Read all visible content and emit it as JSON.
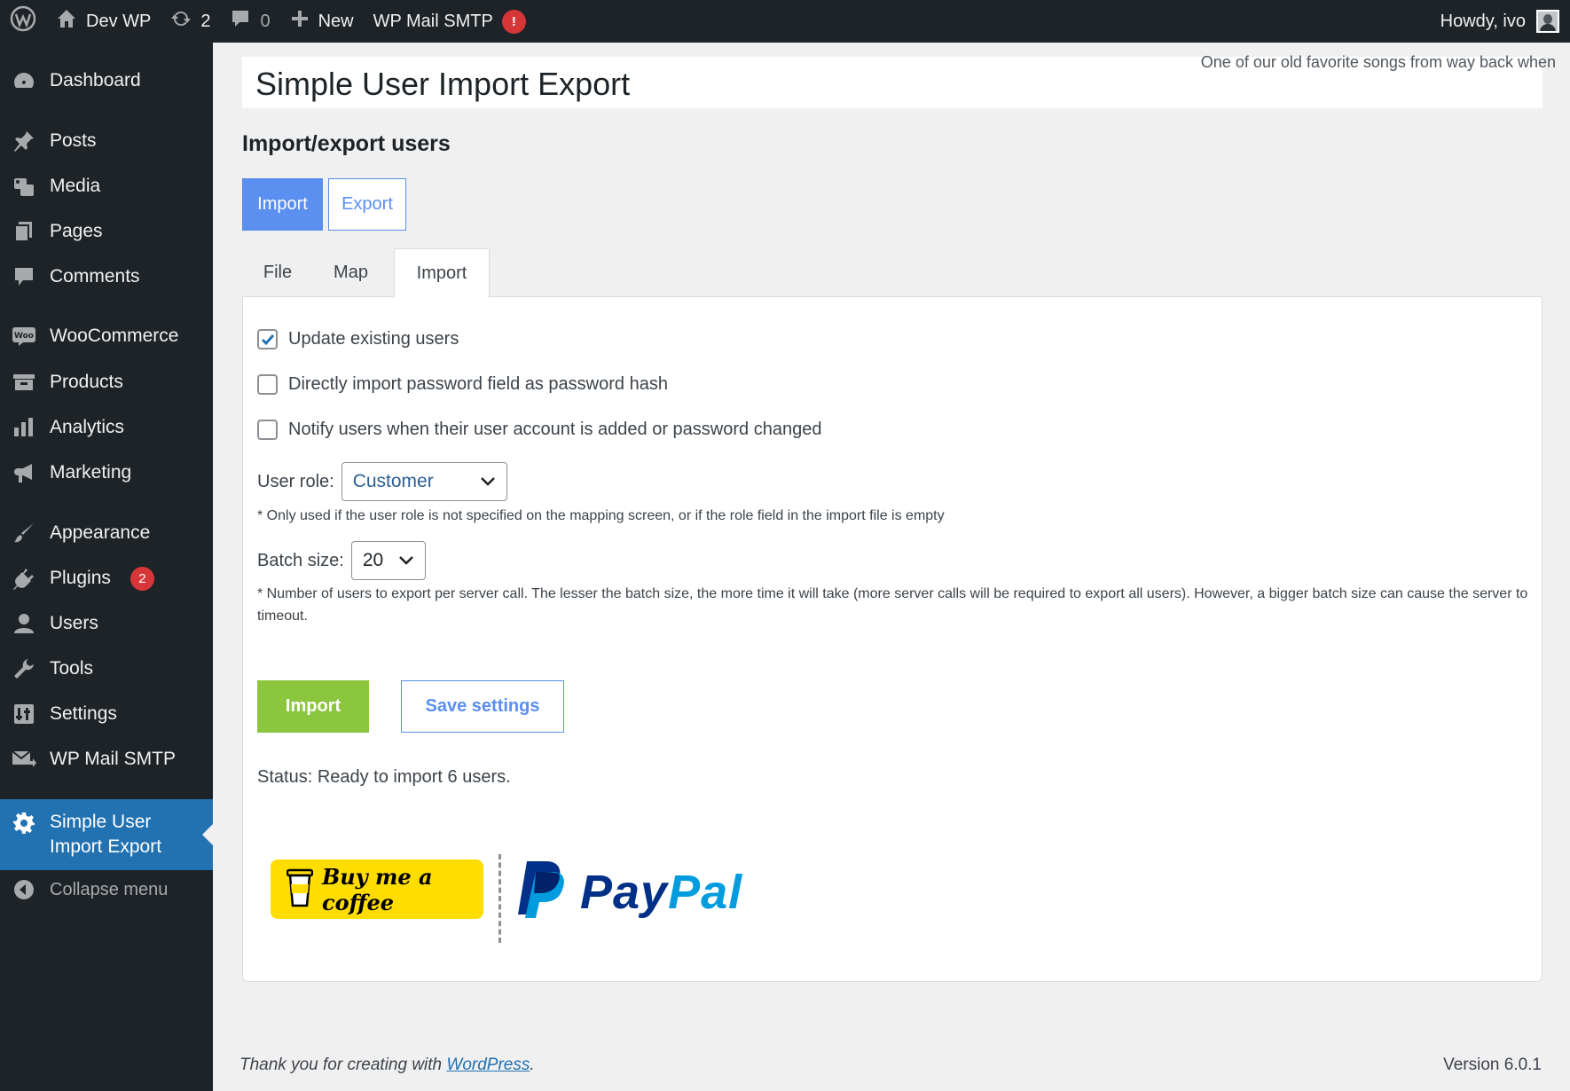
{
  "adminbar": {
    "site_name": "Dev WP",
    "updates_count": "2",
    "comments_count": "0",
    "new_label": "New",
    "smtp_label": "WP Mail SMTP",
    "smtp_alert": "!",
    "howdy": "Howdy, ivo"
  },
  "sidebar": {
    "items": [
      {
        "label": "Dashboard",
        "icon": "dashboard-icon"
      },
      {
        "label": "Posts",
        "icon": "pin-icon"
      },
      {
        "label": "Media",
        "icon": "media-icon"
      },
      {
        "label": "Pages",
        "icon": "pages-icon"
      },
      {
        "label": "Comments",
        "icon": "comment-icon"
      },
      {
        "label": "WooCommerce",
        "icon": "woo-icon"
      },
      {
        "label": "Products",
        "icon": "archive-icon"
      },
      {
        "label": "Analytics",
        "icon": "bar-chart-icon"
      },
      {
        "label": "Marketing",
        "icon": "megaphone-icon"
      },
      {
        "label": "Appearance",
        "icon": "brush-icon"
      },
      {
        "label": "Plugins",
        "icon": "plug-icon",
        "badge": "2"
      },
      {
        "label": "Users",
        "icon": "user-icon"
      },
      {
        "label": "Tools",
        "icon": "wrench-icon"
      },
      {
        "label": "Settings",
        "icon": "settings-icon"
      },
      {
        "label": "WP Mail SMTP",
        "icon": "mail-icon"
      },
      {
        "label_line1": "Simple User",
        "label_line2": "Import Export",
        "icon": "gear-icon",
        "current": true
      },
      {
        "label": "Collapse menu",
        "icon": "collapse-icon"
      }
    ]
  },
  "header": {
    "title": "Simple User Import Export",
    "dolly": "One of our old favorite songs from way back when"
  },
  "main": {
    "section_title": "Import/export users",
    "mode_buttons": {
      "import": "Import",
      "export": "Export"
    },
    "tabs": {
      "file": "File",
      "map": "Map",
      "import": "Import"
    },
    "options": {
      "update_existing": {
        "label": "Update existing users",
        "checked": true
      },
      "password_hash": {
        "label": "Directly import password field as password hash",
        "checked": false
      },
      "notify": {
        "label": "Notify users when their user account is added or password changed",
        "checked": false
      }
    },
    "user_role": {
      "label": "User role:",
      "value": "Customer",
      "hint": "* Only used if the user role is not specified on the mapping screen, or if the role field in the import file is empty"
    },
    "batch_size": {
      "label": "Batch size:",
      "value": "20",
      "hint": "* Number of users to export per server call. The lesser the batch size, the more time it will take (more server calls will be required to export all users). However, a bigger batch size can cause the server to timeout."
    },
    "buttons": {
      "import": "Import",
      "save": "Save settings"
    },
    "status": "Status: Ready to import 6 users.",
    "donate": {
      "coffee": "Buy me a coffee",
      "paypal_pay": "Pay",
      "paypal_pal": "Pal"
    }
  },
  "footer": {
    "thanks_prefix": "Thank you for creating with ",
    "thanks_link": "WordPress",
    "thanks_suffix": ".",
    "version": "Version 6.0.1"
  },
  "colors": {
    "adminbar_bg": "#1d2327",
    "current_menu": "#2271b1",
    "mode_active": "#5b8ff0",
    "import_button": "#8cc63f",
    "bmc_yellow": "#ffdd00",
    "paypal_dark": "#003087",
    "paypal_light": "#009cde",
    "badge_red": "#d63638"
  }
}
